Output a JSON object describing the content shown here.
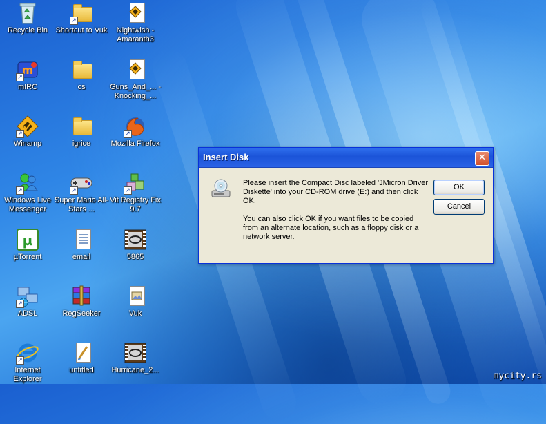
{
  "desktop": {
    "icons": [
      {
        "label": "Recycle Bin",
        "icon": "recycle-bin-icon"
      },
      {
        "label": "Shortcut to Vuk",
        "icon": "folder-icon"
      },
      {
        "label": "Nightwish - Amaranth3",
        "icon": "media-file-icon"
      },
      {
        "label": "mIRC",
        "icon": "mirc-icon"
      },
      {
        "label": "cs",
        "icon": "folder-icon"
      },
      {
        "label": "Guns_And_... - Knocking_...",
        "icon": "media-file-icon"
      },
      {
        "label": "Winamp",
        "icon": "winamp-icon"
      },
      {
        "label": "igrice",
        "icon": "folder-icon"
      },
      {
        "label": "Mozilla Firefox",
        "icon": "firefox-icon"
      },
      {
        "label": "Windows Live Messenger",
        "icon": "messenger-icon"
      },
      {
        "label": "Super Mario All-Stars ...",
        "icon": "gamepad-icon"
      },
      {
        "label": "Vit Registry Fix 9.7",
        "icon": "registry-fix-icon"
      },
      {
        "label": "µTorrent",
        "icon": "utorrent-icon"
      },
      {
        "label": "email",
        "icon": "text-document-icon"
      },
      {
        "label": "5865",
        "icon": "film-icon"
      },
      {
        "label": "ADSL",
        "icon": "network-connection-icon"
      },
      {
        "label": "RegSeeker",
        "icon": "winrar-archive-icon"
      },
      {
        "label": "Vuk",
        "icon": "image-file-icon"
      },
      {
        "label": "Internet Explorer",
        "icon": "internet-explorer-icon"
      },
      {
        "label": "untitled",
        "icon": "paint-image-icon"
      },
      {
        "label": "Hurricane_2...",
        "icon": "film-icon"
      }
    ]
  },
  "dialog": {
    "title": "Insert Disk",
    "message1": "Please insert the Compact Disc labeled 'JMicron Driver Diskette' into your CD-ROM drive (E:) and then click OK.",
    "message2": "You can also click OK if you want files to be copied from an alternate location, such as a floppy disk or a network server.",
    "ok_label": "OK",
    "cancel_label": "Cancel",
    "close_glyph": "✕"
  },
  "watermark": "mycity.rs",
  "colors": {
    "title_bar": "#1b54d8",
    "dialog_bg": "#ece9d8",
    "close_button": "#d2502c"
  }
}
